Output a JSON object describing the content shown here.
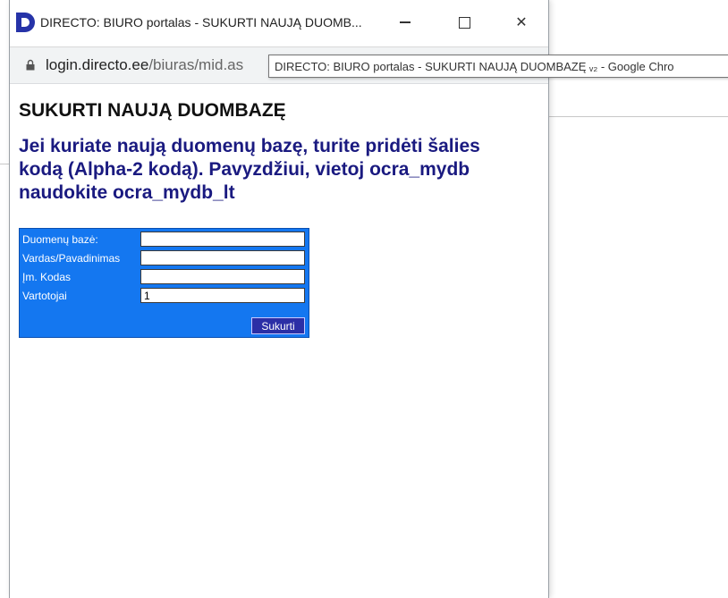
{
  "window": {
    "title": "DIRECTO: BIURO portalas - SUKURTI NAUJĄ DUOMB...",
    "controls": {
      "minimize": "—",
      "close": "✕"
    }
  },
  "address": {
    "host": "login.directo.ee",
    "path": "/biuras/mid.as"
  },
  "tooltip": {
    "text": "DIRECTO: BIURO portalas - SUKURTI NAUJĄ DUOMBAZĘ ᵥ₂ - Google Chro"
  },
  "page": {
    "title": "SUKURTI NAUJĄ DUOMBAZĘ",
    "notice": "Jei kuriate naują duomenų bazę, turite pridėti šalies kodą (Alpha-2 kodą). Pavyzdžiui, vietoj ocra_mydb naudokite ocra_mydb_lt"
  },
  "form": {
    "fields": [
      {
        "label": "Duomenų bazė:",
        "value": ""
      },
      {
        "label": "Vardas/Pavadinimas",
        "value": ""
      },
      {
        "label": "Įm. Kodas",
        "value": ""
      },
      {
        "label": "Vartotojai",
        "value": "1"
      }
    ],
    "submit_label": "Sukurti"
  },
  "colors": {
    "form_background": "#1477f0",
    "notice_text": "#1a1a80",
    "submit_button": "#2b2fa6",
    "logo": "#2633a8"
  },
  "icons": [
    "directo-logo-icon",
    "lock-icon",
    "minimize-icon",
    "maximize-icon",
    "close-icon"
  ]
}
